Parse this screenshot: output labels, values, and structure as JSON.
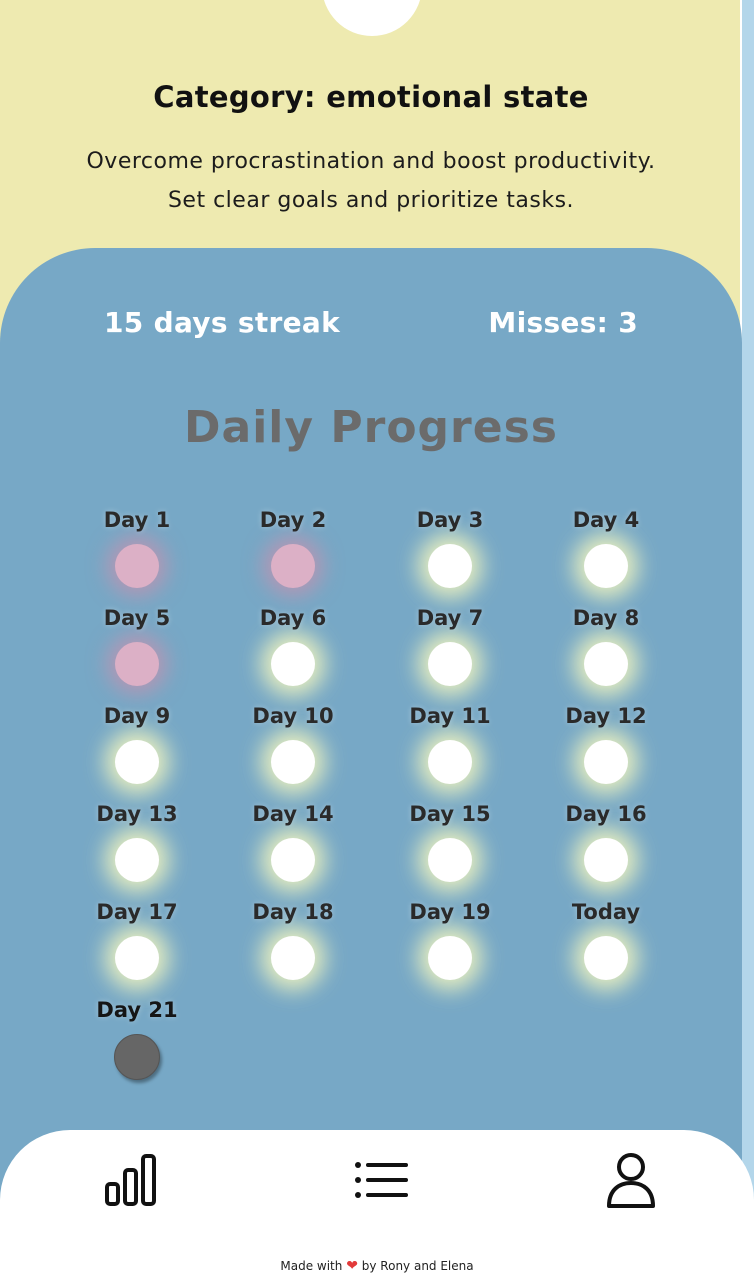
{
  "header": {
    "category": "Category: emotional state",
    "description_line1": "Overcome procrastination and boost productivity.",
    "description_line2": "Set clear goals and prioritize tasks."
  },
  "stats": {
    "streak": "15 days streak",
    "misses": "Misses: 3"
  },
  "progress": {
    "title": "Daily Progress",
    "days": [
      {
        "label": "Day 1",
        "status": "missed"
      },
      {
        "label": "Day 2",
        "status": "missed"
      },
      {
        "label": "Day 3",
        "status": "done"
      },
      {
        "label": "Day 4",
        "status": "done"
      },
      {
        "label": "Day 5",
        "status": "missed"
      },
      {
        "label": "Day 6",
        "status": "done"
      },
      {
        "label": "Day 7",
        "status": "done"
      },
      {
        "label": "Day 8",
        "status": "done"
      },
      {
        "label": "Day 9",
        "status": "done"
      },
      {
        "label": "Day 10",
        "status": "done"
      },
      {
        "label": "Day 11",
        "status": "done"
      },
      {
        "label": "Day 12",
        "status": "done"
      },
      {
        "label": "Day 13",
        "status": "done"
      },
      {
        "label": "Day 14",
        "status": "done"
      },
      {
        "label": "Day 15",
        "status": "done"
      },
      {
        "label": "Day 16",
        "status": "done"
      },
      {
        "label": "Day 17",
        "status": "done"
      },
      {
        "label": "Day 18",
        "status": "done"
      },
      {
        "label": "Day 19",
        "status": "done"
      },
      {
        "label": "Today",
        "status": "done"
      },
      {
        "label": "Day 21",
        "status": "pending"
      }
    ]
  },
  "nav": {
    "items": [
      {
        "icon": "bar-chart-icon"
      },
      {
        "icon": "list-icon"
      },
      {
        "icon": "user-icon"
      }
    ]
  },
  "footer": {
    "prefix": "Made with",
    "suffix": "by Rony and Elena",
    "heart_color": "#e23a3a"
  },
  "colors": {
    "background": "#eeeab0",
    "panel": "#77a8c6",
    "missed_dot": "#dcb0c6",
    "done_dot": "#ffffff",
    "pending_dot": "#666666"
  }
}
